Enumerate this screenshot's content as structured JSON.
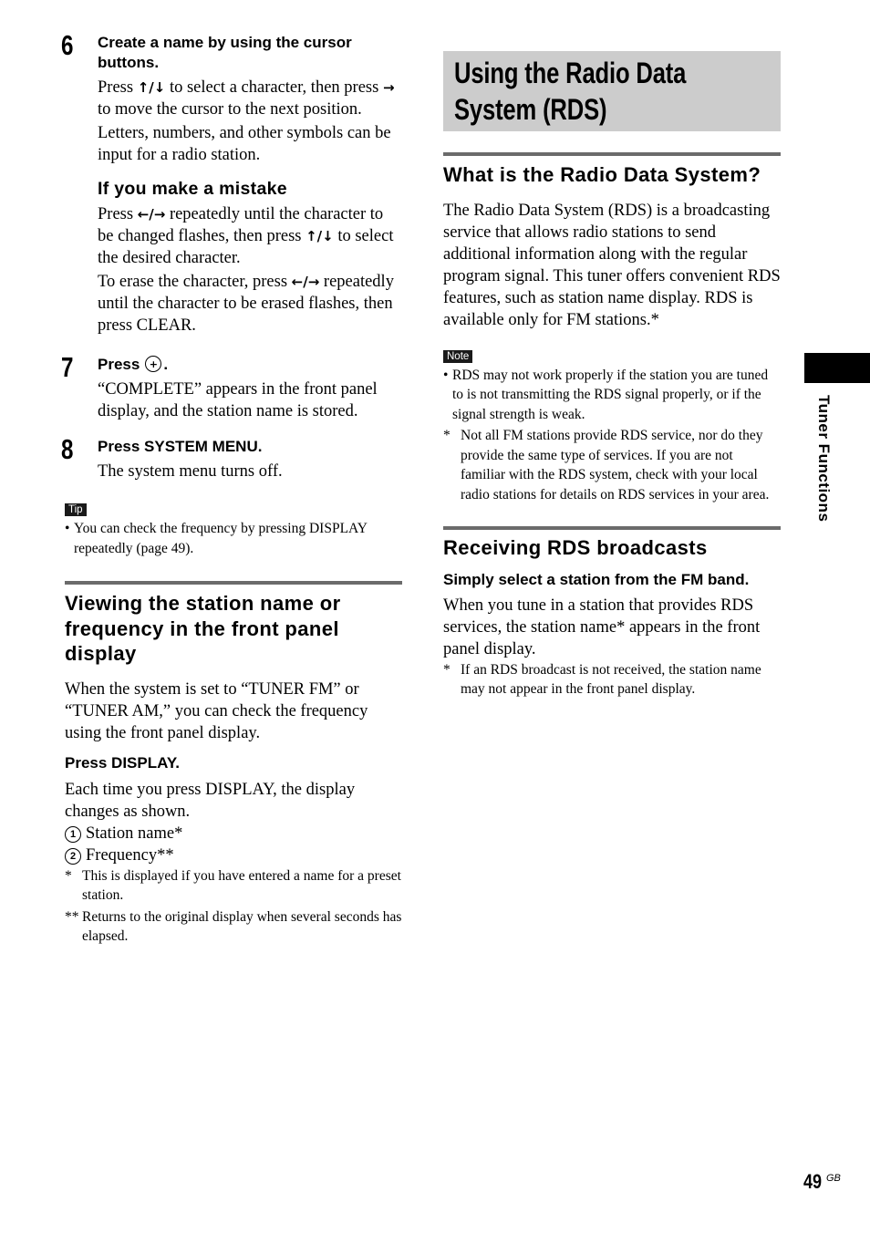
{
  "left": {
    "step6": {
      "number": "6",
      "title": "Create a name by using the cursor buttons.",
      "para1_before": "Press ",
      "para1_arrows1": "↑/↓",
      "para1_mid": " to select a character, then press ",
      "para1_arrows2": "→",
      "para1_after": " to move the cursor to the next position.",
      "para2": "Letters, numbers, and other symbols can be input for a radio station.",
      "subhead": "If you make a mistake",
      "para3_before": "Press ",
      "para3_arrows1": "←/→",
      "para3_mid": " repeatedly until the character to be changed flashes, then press ",
      "para3_arrows2": "↑/↓",
      "para3_after": " to select the desired character.",
      "para4_before": "To erase the character, press ",
      "para4_arrows": "←/→",
      "para4_after": " repeatedly until the character to be erased flashes, then press CLEAR."
    },
    "step7": {
      "number": "7",
      "title_before": "Press",
      "title_after": ".",
      "icon": "enter-button-icon",
      "para": "“COMPLETE” appears in the front panel display, and the station name is stored."
    },
    "step8": {
      "number": "8",
      "title": "Press SYSTEM MENU.",
      "para": "The system menu turns off."
    },
    "tip": {
      "label": "Tip",
      "bullet": "•",
      "text": "You can check the frequency by pressing DISPLAY repeatedly (page 49)."
    },
    "section": {
      "heading": "Viewing the station name or frequency in the front panel display",
      "intro": "When the system is set to “TUNER FM” or “TUNER AM,” you can check the frequency using the front panel display.",
      "action": "Press DISPLAY.",
      "para": "Each time you press DISPLAY, the display changes as shown.",
      "list": [
        {
          "num": "1",
          "text": "Station name*"
        },
        {
          "num": "2",
          "text": "Frequency**"
        }
      ],
      "footnotes": [
        {
          "mark": "*",
          "text": "This is displayed if you have entered a name for a preset station."
        },
        {
          "mark": "**",
          "text": "Returns to the original display when several seconds has elapsed."
        }
      ]
    }
  },
  "right": {
    "banner_title": "Using the Radio Data System (RDS)",
    "section1": {
      "heading": "What is the Radio Data System?",
      "para": "The Radio Data System (RDS) is a broadcasting service that allows radio stations to send additional information along with the regular program signal. This tuner offers convenient RDS features, such as station name display. RDS is available only for FM stations.*"
    },
    "note": {
      "label": "Note",
      "bullet": "•",
      "text": "RDS may not work properly if the station you are tuned to is not transmitting the RDS signal properly, or if the signal strength is weak.",
      "footnote_mark": "*",
      "footnote": "Not all FM stations provide RDS service, nor do they provide the same type of services. If you are not familiar with the RDS system, check with your local radio stations for details on RDS services in your area."
    },
    "section2": {
      "heading": "Receiving RDS broadcasts",
      "action": "Simply select a station from the FM band.",
      "para": "When you tune in a station that provides RDS services, the station name* appears in the front panel display.",
      "footnote_mark": "*",
      "footnote": "If an RDS broadcast is not received, the station name may not appear in the front panel display."
    }
  },
  "side_tab": {
    "label": "Tuner Functions"
  },
  "page": {
    "number": "49",
    "suffix": "GB"
  }
}
